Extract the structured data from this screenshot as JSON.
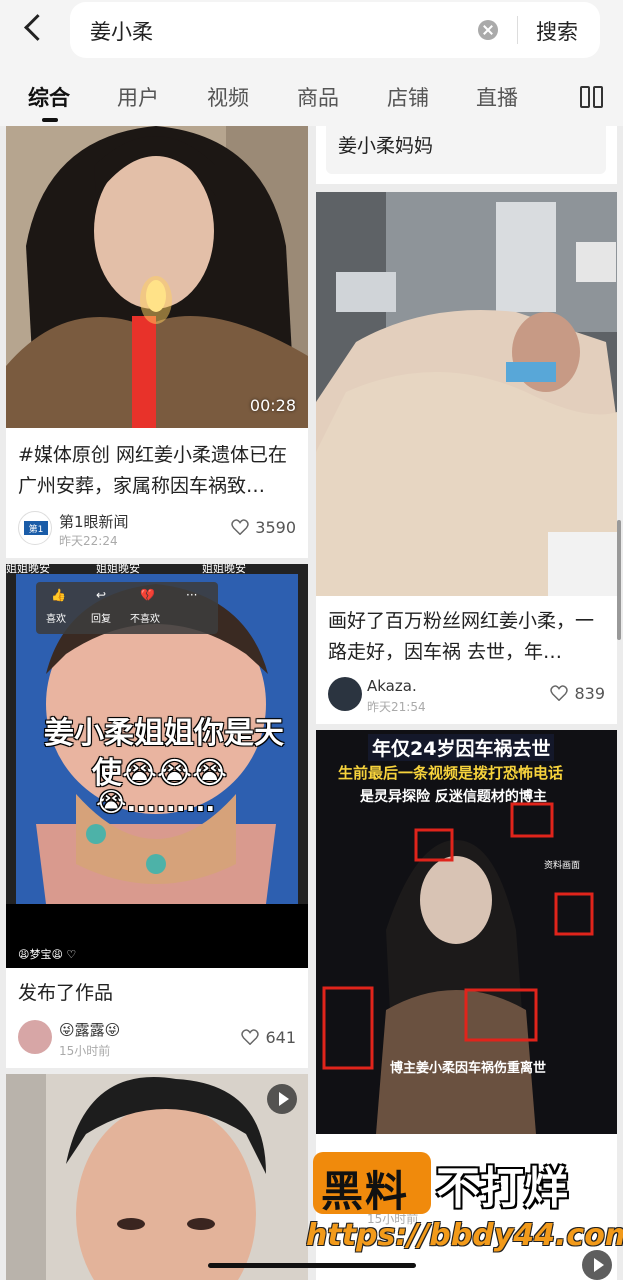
{
  "search": {
    "query": "姜小柔",
    "button": "搜索"
  },
  "tabs": [
    {
      "label": "综合",
      "active": true
    },
    {
      "label": "用户"
    },
    {
      "label": "视频"
    },
    {
      "label": "商品"
    },
    {
      "label": "店铺"
    },
    {
      "label": "直播"
    }
  ],
  "related_search": "姜小柔妈妈",
  "cards": {
    "c1": {
      "duration": "00:28",
      "title": "#媒体原创 网红姜小柔遗体已在广州安葬，家属称因车祸致…",
      "author": "第1眼新闻",
      "time": "昨天22:24",
      "likes": "3590"
    },
    "c2": {
      "title": "画好了百万粉丝网红姜小柔，一路走好，因车祸 去世，年…",
      "author": "Akaza.",
      "time": "昨天21:54",
      "likes": "839"
    },
    "c3": {
      "top_texts": [
        "姐姐晚安",
        "姐姐晚安",
        "姐姐晚安"
      ],
      "menu": [
        "喜欢",
        "回复",
        "不喜欢"
      ],
      "overlay_line1": "姜小柔姐姐你是天",
      "overlay_line2": "使😭😭😭",
      "overlay_line3": "😭.........",
      "comment_user": "😩梦宝😩 ♡",
      "title": "发布了作品",
      "author": "😜露露😜",
      "time": "15小时前",
      "likes": "641"
    },
    "c4": {
      "headline": "年仅24岁因车祸去世",
      "sub1": "生前最后一条视频是拨打恐怖电话",
      "sub2": "是灵异探险 反迷信题材的博主",
      "tag": "资料画面",
      "caption": "博主姜小柔因车祸伤重离世",
      "time_partial": "15小时前"
    }
  },
  "watermark": {
    "box": "黑料",
    "text": "不打烊",
    "url": "https://bbdy44.com"
  },
  "colors": {
    "watermark_orange": "#f08a0c",
    "red_box": "#e0241b"
  }
}
